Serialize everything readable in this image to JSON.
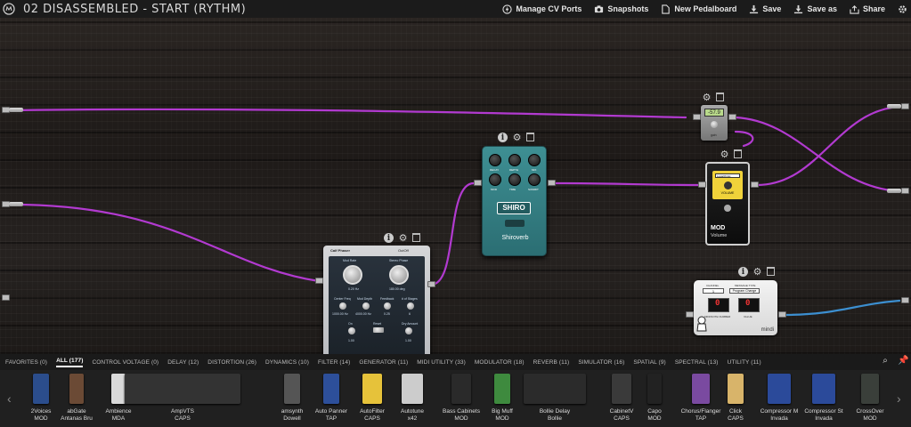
{
  "app": {
    "title": "02 DISASSEMBLED - START (RYTHM)"
  },
  "toolbar": {
    "manage_cv": "Manage CV Ports",
    "snapshots": "Snapshots",
    "new_pedalboard": "New Pedalboard",
    "save": "Save",
    "save_as": "Save as",
    "share": "Share"
  },
  "pedals": {
    "shiro": {
      "brand_logo": "SHIRO",
      "name": "Shiroverb",
      "knobs": [
        "DECAY",
        "DEPTH",
        "MIX",
        "PRE DELAY",
        "MOD",
        "TIME",
        "SUMMIT"
      ]
    },
    "calf": {
      "title": "Calf Phaser",
      "out": "OutOff",
      "labels": [
        "Mod Rate",
        "Stereo Phase",
        "0.20 Hz",
        "180.00 deg",
        "Center Freq",
        "Mod Depth",
        "Feedback",
        "# of Stages",
        "1000.00 Hz",
        "4000.00 Hz",
        "0.25",
        "6",
        "On",
        "Reset",
        "Dry Amount",
        "1.00",
        "1.00"
      ]
    },
    "gain": {
      "display": "-57.9",
      "label": "gain"
    },
    "volume": {
      "select": "Logarithmic",
      "knob_label": "VOLUME",
      "brand": "MOD",
      "name": "Volume"
    },
    "mindi": {
      "channel": "CHANNEL",
      "message_type": "MESSAGE TYPE",
      "channel_value": "1",
      "message_value": "Program Change",
      "mnumber": "MIDI/NOTE NUMBER",
      "value": "VALUE",
      "digits_left": "0",
      "digits_right": "0",
      "name": "mindi"
    }
  },
  "categories": [
    {
      "label": "FAVORITES (0)"
    },
    {
      "label": "ALL (177)"
    },
    {
      "label": "CONTROL VOLTAGE (0)"
    },
    {
      "label": "DELAY (12)"
    },
    {
      "label": "DISTORTION (26)"
    },
    {
      "label": "DYNAMICS (10)"
    },
    {
      "label": "FILTER (14)"
    },
    {
      "label": "GENERATOR (11)"
    },
    {
      "label": "MIDI UTILITY (33)"
    },
    {
      "label": "MODULATOR (18)"
    },
    {
      "label": "REVERB (11)"
    },
    {
      "label": "SIMULATOR (16)"
    },
    {
      "label": "SPATIAL (9)"
    },
    {
      "label": "SPECTRAL (13)"
    },
    {
      "label": "UTILITY (11)"
    }
  ],
  "active_category": "ALL (177)",
  "plugins": [
    {
      "name": "2Voices",
      "brand": "MOD",
      "color": "#2b4d8c"
    },
    {
      "name": "abGate",
      "brand": "Antanas Bru",
      "color": "#6b4a35"
    },
    {
      "name": "Ambience",
      "brand": "MDA",
      "color": "#d9d9d9"
    },
    {
      "name": "AmpVTS",
      "brand": "CAPS",
      "color": "#333333"
    },
    {
      "name": "amsynth",
      "brand": "Dowell",
      "color": "#555555"
    },
    {
      "name": "Auto Panner",
      "brand": "TAP",
      "color": "#2d4f9a"
    },
    {
      "name": "AutoFilter",
      "brand": "CAPS",
      "color": "#e6c23a"
    },
    {
      "name": "Autotune",
      "brand": "x42",
      "color": "#cccccc"
    },
    {
      "name": "Bass Cabinets",
      "brand": "MOD",
      "color": "#2a2a2a"
    },
    {
      "name": "Big Muff",
      "brand": "MOD",
      "color": "#3e8a3e"
    },
    {
      "name": "Bollie Delay",
      "brand": "Bollie",
      "color": "#2b2b2b"
    },
    {
      "name": "CabinetV",
      "brand": "CAPS",
      "color": "#3a3a3a"
    },
    {
      "name": "Capo",
      "brand": "MOD",
      "color": "#222222"
    },
    {
      "name": "Chorus/Flanger",
      "brand": "TAP",
      "color": "#7a4aa0"
    },
    {
      "name": "Click",
      "brand": "CAPS",
      "color": "#d8b46a"
    },
    {
      "name": "Compressor M",
      "brand": "Invada",
      "color": "#2b4a9a"
    },
    {
      "name": "Compressor St",
      "brand": "Invada",
      "color": "#2b4a9a"
    },
    {
      "name": "CrossOver",
      "brand": "MOD",
      "color": "#3a3f3a"
    }
  ],
  "colors": {
    "cable_audio": "#b23ad0",
    "cable_midi": "#3c8fd0",
    "accent": "#ffffff"
  }
}
